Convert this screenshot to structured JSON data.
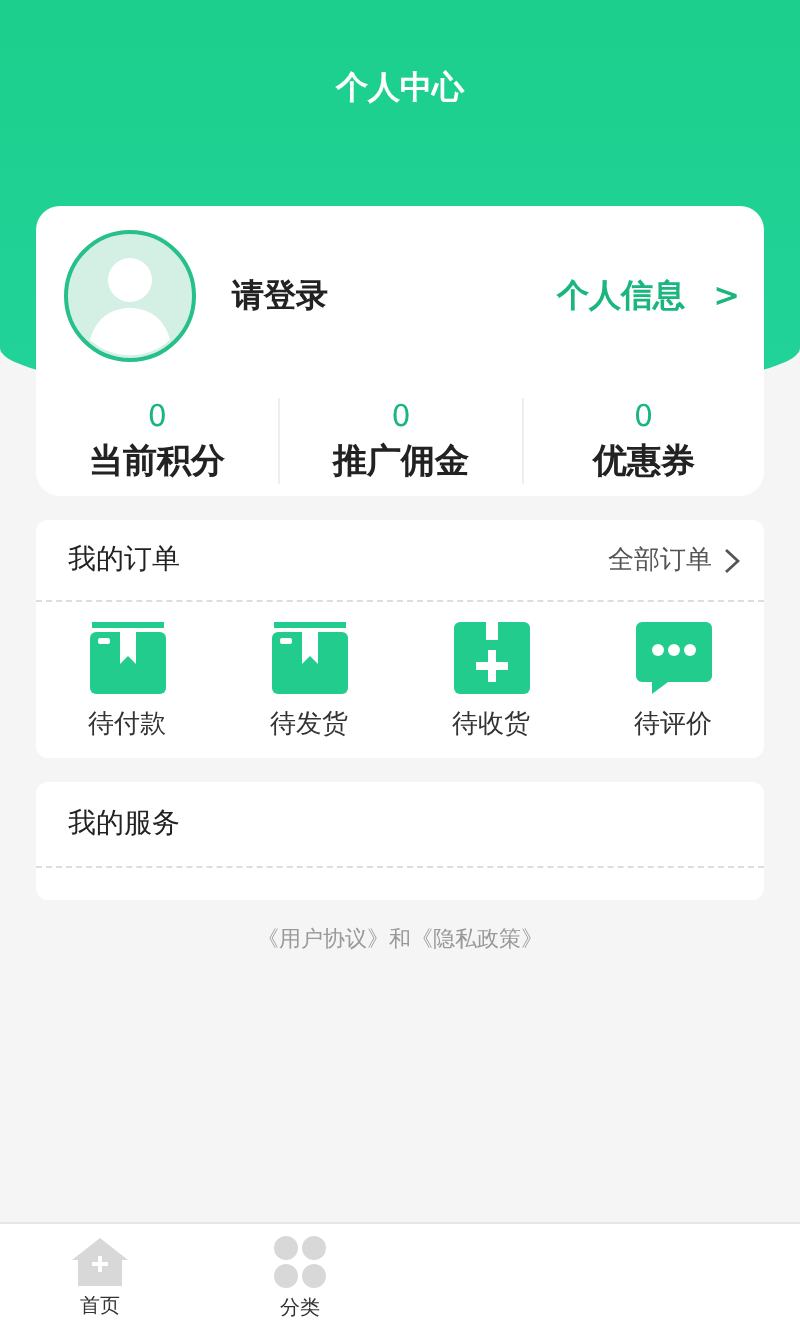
{
  "header": {
    "title": "个人中心"
  },
  "profile": {
    "name": "请登录",
    "info_link": "个人信息",
    "info_arrow": ">"
  },
  "stats": [
    {
      "value": "0",
      "label": "当前积分"
    },
    {
      "value": "0",
      "label": "推广佣金"
    },
    {
      "value": "0",
      "label": "优惠券"
    }
  ],
  "orders": {
    "title": "我的订单",
    "all_link": "全部订单",
    "items": [
      {
        "kind": "box",
        "label": "待付款"
      },
      {
        "kind": "box",
        "label": "待发货"
      },
      {
        "kind": "plus",
        "label": "待收货"
      },
      {
        "kind": "chat",
        "label": "待评价"
      }
    ]
  },
  "services": {
    "title": "我的服务"
  },
  "footer": "《用户协议》和《隐私政策》",
  "tab_bar": [
    {
      "kind": "home",
      "label": "首页",
      "selected": false
    },
    {
      "kind": "grid",
      "label": "分类",
      "selected": false
    }
  ]
}
